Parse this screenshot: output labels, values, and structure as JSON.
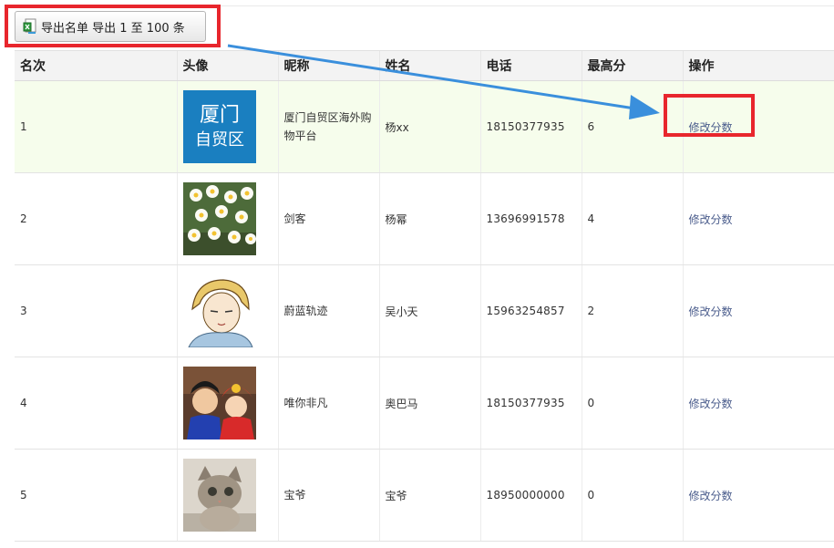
{
  "export": {
    "label": "导出名单 导出 1 至 100 条",
    "icon": "excel-export-icon"
  },
  "table": {
    "headers": [
      "名次",
      "头像",
      "昵称",
      "姓名",
      "电话",
      "最高分",
      "操作"
    ],
    "rows": [
      {
        "rank": "1",
        "avatar": "xiamen-logo",
        "avatar_text_1": "厦门",
        "avatar_text_2": "自贸区",
        "nickname": "厦门自贸区海外购物平台",
        "name": "杨xx",
        "phone": "18150377935",
        "score": "6",
        "action": "修改分数"
      },
      {
        "rank": "2",
        "avatar": "narcissus-flowers",
        "nickname": "剑客",
        "name": "杨幂",
        "phone": "13696991578",
        "score": "4",
        "action": "修改分数"
      },
      {
        "rank": "3",
        "avatar": "anime-character",
        "nickname": "蔚蓝轨迹",
        "name": "吴小天",
        "phone": "15963254857",
        "score": "2",
        "action": "修改分数"
      },
      {
        "rank": "4",
        "avatar": "couple-photo",
        "nickname": "唯你非凡",
        "name": "奥巴马",
        "phone": "18150377935",
        "score": "0",
        "action": "修改分数"
      },
      {
        "rank": "5",
        "avatar": "kitten",
        "nickname": "宝爷",
        "name": "宝爷",
        "phone": "18950000000",
        "score": "0",
        "action": "修改分数"
      }
    ]
  },
  "colors": {
    "callout": "#e8262d",
    "arrow": "#3a8fdc",
    "highlight_row": "#f6fdec",
    "link": "#4a5c8c"
  }
}
